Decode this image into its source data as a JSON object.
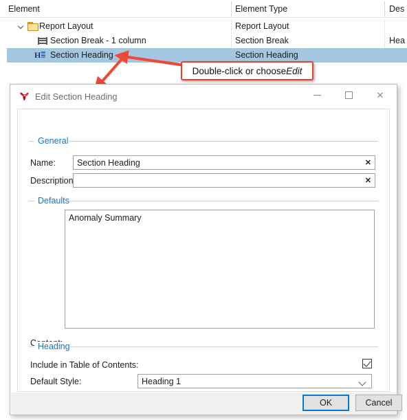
{
  "grid": {
    "columns": [
      {
        "label": "Element"
      },
      {
        "label": "Element Type"
      },
      {
        "label": "Des"
      }
    ],
    "rows": [
      {
        "element": "Report Layout",
        "element_type": "Report Layout",
        "description": "",
        "icon": "folder-icon",
        "indent": 1,
        "expanded": true,
        "selected": false
      },
      {
        "element": "Section Break - 1 column",
        "element_type": "Section Break",
        "description": "Hea",
        "icon": "section-break-icon",
        "indent": 2,
        "expanded": false,
        "selected": false
      },
      {
        "element": "Section Heading",
        "element_type": "Section Heading",
        "description": "",
        "icon": "section-heading-icon",
        "indent": 2,
        "expanded": false,
        "selected": true
      }
    ],
    "selected_row_color": "#a5c6df"
  },
  "callout": {
    "text_before": "Double-click or choose ",
    "text_emphasis": "Edit",
    "border_color": "#e8402a",
    "arrow_color": "#ef4836"
  },
  "dialog": {
    "title": "Edit Section Heading",
    "title_icon": "app-logo-icon",
    "window_buttons": {
      "minimize": "minimize-icon",
      "maximize": "maximize-icon",
      "close": "close-icon",
      "close_glyph": "✕"
    },
    "groups": {
      "general": {
        "legend": "General",
        "name_label": "Name:",
        "name_value": "Section Heading",
        "name_placeholder": "",
        "description_label": "Description:",
        "description_value": "",
        "description_placeholder": "",
        "clear_glyph": "✕"
      },
      "defaults": {
        "legend": "Defaults",
        "content_label": "Content:",
        "content_value": "Anomaly Summary",
        "content_placeholder": ""
      },
      "heading": {
        "legend": "Heading",
        "include_toc_label": "Include in Table of Contents:",
        "include_toc_checked": true,
        "default_style_label": "Default Style:",
        "default_style_value": "Heading 1",
        "default_style_options": [
          "Heading 1"
        ]
      }
    },
    "footer": {
      "ok_label": "OK",
      "cancel_label": "Cancel"
    },
    "accent_color": "#0078d7",
    "group_legend_color": "#1673c4"
  }
}
